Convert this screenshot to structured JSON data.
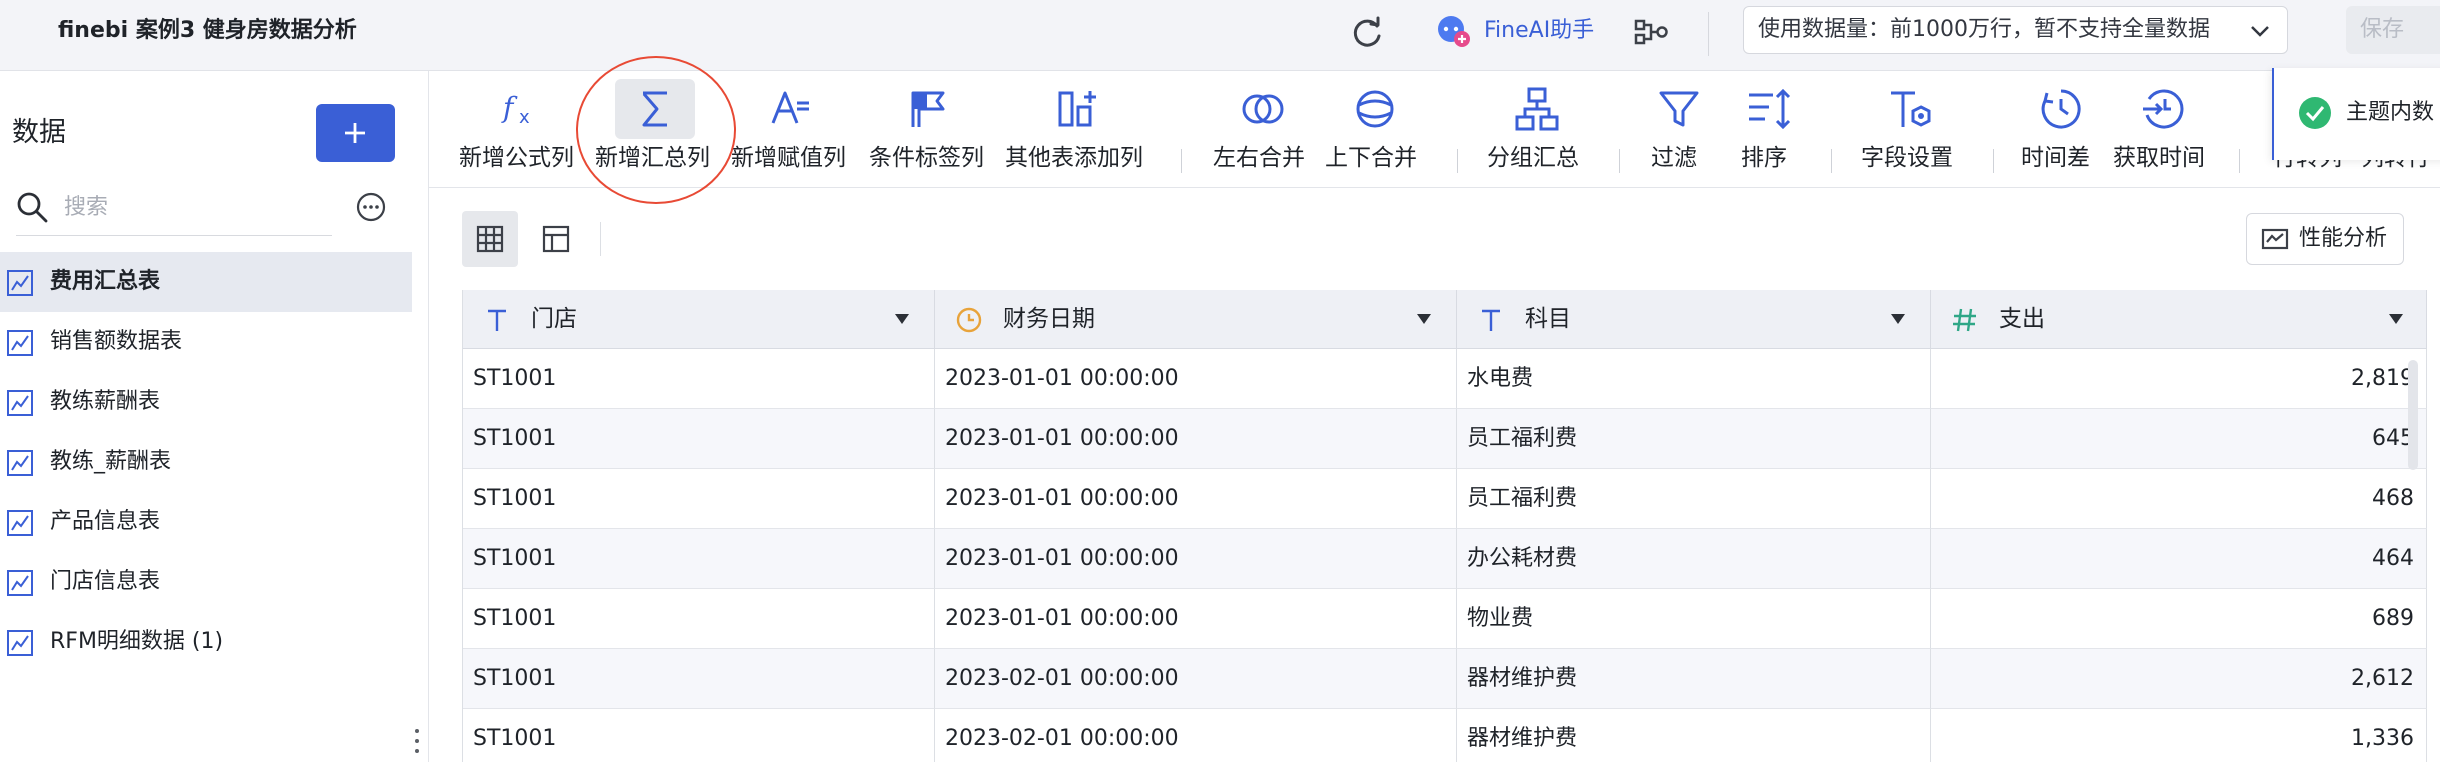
{
  "header": {
    "title": "finebi 案例3 健身房数据分析",
    "ai_label": "FineAI助手",
    "data_usage": "使用数据量：前1000万行，暂不支持全量数据",
    "save_label": "保存"
  },
  "sidebar": {
    "title": "数据",
    "search_placeholder": "搜索",
    "items": [
      {
        "label": "费用汇总表"
      },
      {
        "label": "销售额数据表"
      },
      {
        "label": "教练薪酬表"
      },
      {
        "label": "教练_薪酬表"
      },
      {
        "label": "产品信息表"
      },
      {
        "label": "门店信息表"
      },
      {
        "label": "RFM明细数据 (1)"
      }
    ]
  },
  "toolbar": {
    "items": [
      {
        "label": "新增公式列",
        "icon": "formula-icon"
      },
      {
        "label": "新增汇总列",
        "icon": "sigma-icon",
        "highlighted": true
      },
      {
        "label": "新增赋值列",
        "icon": "assign-icon"
      },
      {
        "label": "条件标签列",
        "icon": "flag-icon"
      },
      {
        "label": "其他表添加列",
        "icon": "add-column-icon"
      },
      {
        "label": "左右合并",
        "icon": "horizontal-merge-icon"
      },
      {
        "label": "上下合并",
        "icon": "vertical-merge-icon"
      },
      {
        "label": "分组汇总",
        "icon": "group-summary-icon"
      },
      {
        "label": "过滤",
        "icon": "filter-icon"
      },
      {
        "label": "排序",
        "icon": "sort-icon"
      },
      {
        "label": "字段设置",
        "icon": "field-settings-icon"
      },
      {
        "label": "时间差",
        "icon": "time-diff-icon"
      },
      {
        "label": "获取时间",
        "icon": "get-time-icon"
      },
      {
        "label": "行转列",
        "icon": "row-to-column-icon"
      },
      {
        "label": "列转行",
        "icon": "column-to-row-icon"
      }
    ]
  },
  "notice": {
    "text": "主题内数"
  },
  "view": {
    "perf_label": "性能分析"
  },
  "table": {
    "columns": [
      {
        "label": "门店",
        "type": "text"
      },
      {
        "label": "财务日期",
        "type": "date"
      },
      {
        "label": "科目",
        "type": "text"
      },
      {
        "label": "支出",
        "type": "number"
      }
    ],
    "rows": [
      [
        "ST1001",
        "2023-01-01 00:00:00",
        "水电费",
        "2,819"
      ],
      [
        "ST1001",
        "2023-01-01 00:00:00",
        "员工福利费",
        "645"
      ],
      [
        "ST1001",
        "2023-01-01 00:00:00",
        "员工福利费",
        "468"
      ],
      [
        "ST1001",
        "2023-01-01 00:00:00",
        "办公耗材费",
        "464"
      ],
      [
        "ST1001",
        "2023-01-01 00:00:00",
        "物业费",
        "689"
      ],
      [
        "ST1001",
        "2023-02-01 00:00:00",
        "器材维护费",
        "2,612"
      ],
      [
        "ST1001",
        "2023-02-01 00:00:00",
        "器材维护费",
        "1,336"
      ]
    ]
  },
  "colors": {
    "accent": "#3a5fd6",
    "annotation": "#e84a35",
    "success": "#2fb872",
    "date_icon": "#e8a33a",
    "number_icon": "#2fa787"
  }
}
